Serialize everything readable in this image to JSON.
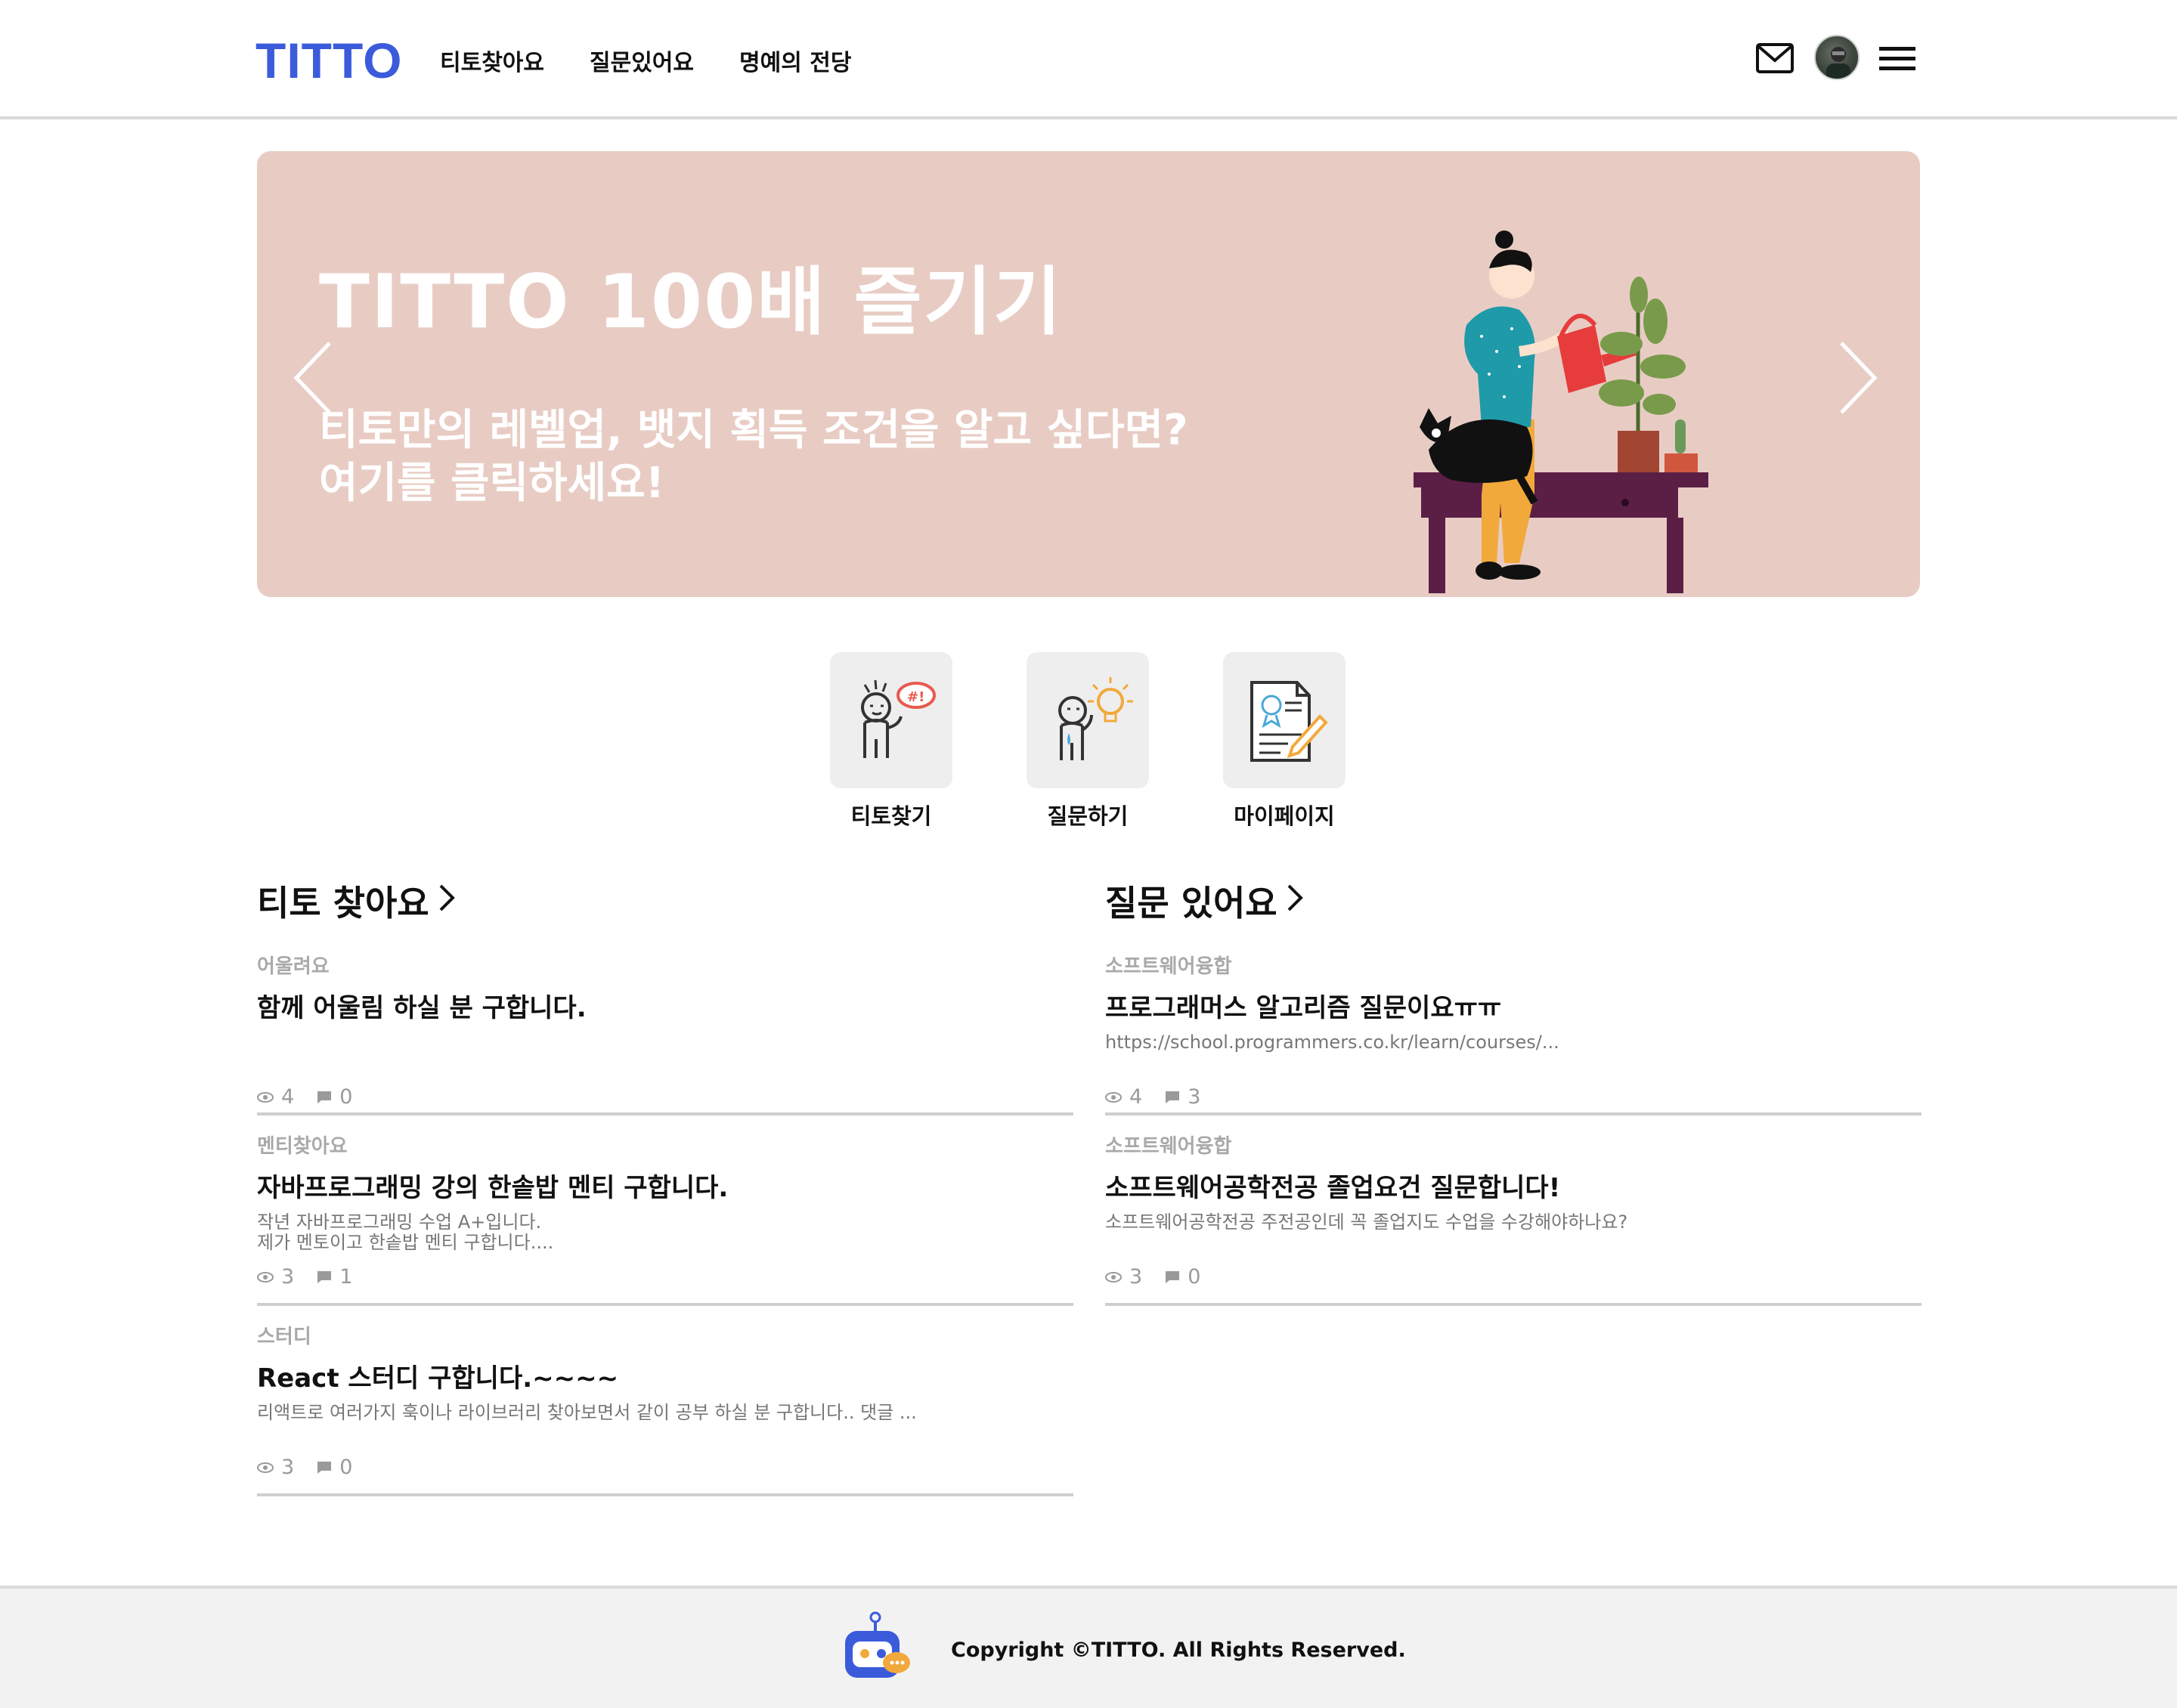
{
  "header": {
    "logo": "TITTO",
    "nav": [
      "티토찾아요",
      "질문있어요",
      "명예의 전당"
    ]
  },
  "banner": {
    "title": "TITTO  100배 즐기기",
    "subtitle_line1": "티토만의 레벨업, 뱃지 획득 조건을 알고 싶다면?",
    "subtitle_line2": "여기를 클릭하세요!"
  },
  "quick_menu": [
    {
      "label": "티토찾기",
      "icon": "person-shouting-icon"
    },
    {
      "label": "질문하기",
      "icon": "person-lightbulb-icon"
    },
    {
      "label": "마이페이지",
      "icon": "document-pencil-icon"
    }
  ],
  "titto_section": {
    "title": "티토 찾아요",
    "posts": [
      {
        "category": "어울려요",
        "title": "함께 어울림 하실 분 구합니다.",
        "body": "",
        "views": "4",
        "comments": "0"
      },
      {
        "category": "멘티찾아요",
        "title": "자바프로그래밍 강의 한솥밥 멘티 구합니다.",
        "body": "작년 자바프로그래밍 수업 A+입니다.\n제가 멘토이고 한솥밥 멘티 구합니다....",
        "views": "3",
        "comments": "1"
      },
      {
        "category": "스터디",
        "title": "React 스터디 구합니다.~~~~",
        "body": "리액트로 여러가지 훅이나 라이브러리 찾아보면서 같이 공부 하실 분 구합니다.. 댓글 ...",
        "views": "3",
        "comments": "0"
      }
    ]
  },
  "question_section": {
    "title": "질문 있어요",
    "posts": [
      {
        "category": "소프트웨어융합",
        "title": "프로그래머스 알고리즘 질문이요ㅠㅠ",
        "body": "https://school.programmers.co.kr/learn/courses/...",
        "views": "4",
        "comments": "3"
      },
      {
        "category": "소프트웨어융합",
        "title": "소프트웨어공학전공 졸업요건 질문합니다!",
        "body": "소프트웨어공학전공 주전공인데 꼭 졸업지도 수업을 수강해야하나요?",
        "views": "3",
        "comments": "0"
      }
    ]
  },
  "footer": {
    "copyright": "Copyright ©TITTO. All Rights Reserved."
  },
  "colors": {
    "brand": "#3b5bdb",
    "banner_bg": "#e8ccc4"
  }
}
